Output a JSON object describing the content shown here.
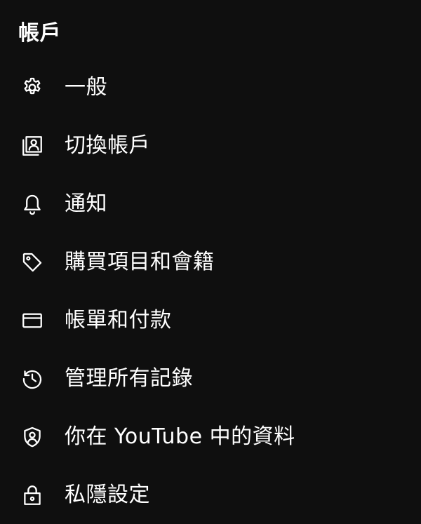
{
  "page": {
    "section_title": "帳戶"
  },
  "menu": {
    "items": [
      {
        "label": "一般",
        "icon": "gear-icon"
      },
      {
        "label": "切換帳戶",
        "icon": "switch-account-icon"
      },
      {
        "label": "通知",
        "icon": "bell-icon"
      },
      {
        "label": "購買項目和會籍",
        "icon": "tag-icon"
      },
      {
        "label": "帳單和付款",
        "icon": "credit-card-icon"
      },
      {
        "label": "管理所有記錄",
        "icon": "history-icon"
      },
      {
        "label": "你在 YouTube 中的資料",
        "icon": "shield-person-icon"
      },
      {
        "label": "私隱設定",
        "icon": "lock-icon"
      }
    ]
  },
  "colors": {
    "background": "#0f0f0f",
    "text": "#ffffff"
  }
}
